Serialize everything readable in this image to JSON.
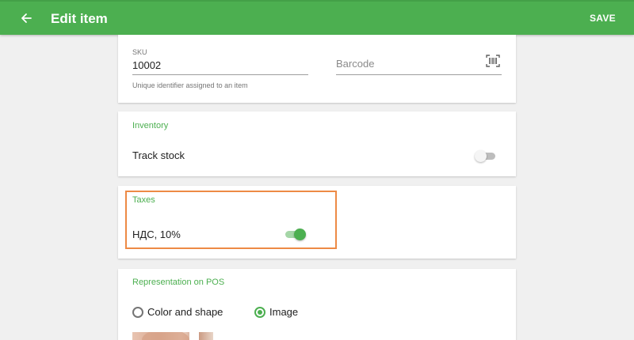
{
  "appbar": {
    "title": "Edit item",
    "save_label": "SAVE",
    "color": "#4caf50"
  },
  "identity": {
    "sku_label": "SKU",
    "sku_value": "10002",
    "sku_help": "Unique identifier assigned to an item",
    "barcode_placeholder": "Barcode"
  },
  "inventory": {
    "title": "Inventory",
    "track_stock_label": "Track stock",
    "track_stock_on": false
  },
  "taxes": {
    "title": "Taxes",
    "items": [
      {
        "label": "НДС, 10%",
        "enabled": true
      }
    ]
  },
  "representation": {
    "title": "Representation on POS",
    "options": [
      {
        "label": "Color and shape",
        "selected": false
      },
      {
        "label": "Image",
        "selected": true
      }
    ]
  },
  "icons": {
    "back": "arrow-left-icon",
    "barcode": "barcode-scan-icon"
  },
  "colors": {
    "accent": "#4caf50",
    "highlight": "#ed8a45"
  }
}
